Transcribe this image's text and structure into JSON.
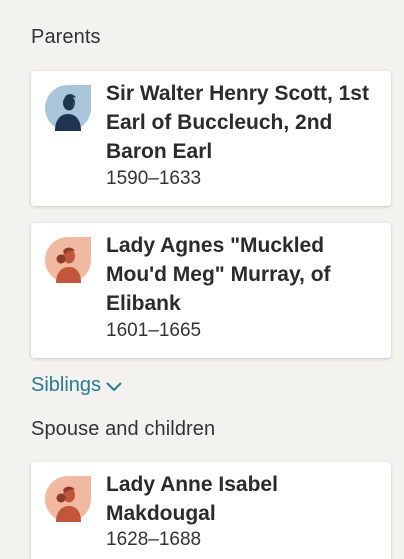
{
  "parents": {
    "title": "Parents",
    "people": [
      {
        "name": "Sir Walter Henry Scott, 1st Earl of Buccleuch, 2nd Baron Earl",
        "dates": "1590–1633",
        "avatar_icon": "male-avatar-icon"
      },
      {
        "name": "Lady Agnes \"Muckled Mou'd Meg\" Murray, of Elibank",
        "dates": "1601–1665",
        "avatar_icon": "female-avatar-icon"
      }
    ]
  },
  "siblings": {
    "label": "Siblings",
    "icon": "chevron-down-icon"
  },
  "spouse_children": {
    "title": "Spouse and children",
    "people": [
      {
        "name": "Lady Anne Isabel Makdougal",
        "dates": "1628–1688",
        "avatar_icon": "female-avatar-icon"
      }
    ]
  },
  "colors": {
    "background": "#f4f2ef",
    "link": "#2a7a95",
    "male_avatar_bg": "#a9c6d9",
    "female_avatar_bg": "#f2b9a2"
  }
}
